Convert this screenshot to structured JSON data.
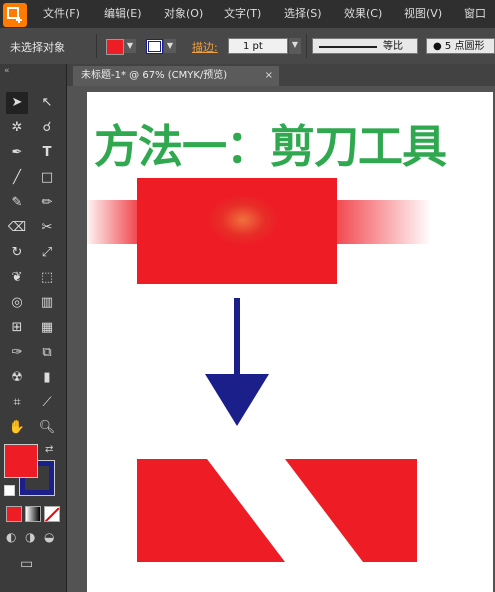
{
  "menu": {
    "items": [
      "文件(F)",
      "编辑(E)",
      "对象(O)",
      "文字(T)",
      "选择(S)",
      "效果(C)",
      "视图(V)",
      "窗口"
    ]
  },
  "control_bar": {
    "selection_label": "未选择对象",
    "stroke_label": "描边:",
    "stroke_weight": "1 pt",
    "stroke_profile": "等比",
    "brush": "5 点圆形"
  },
  "document_tab": {
    "title": "未标题-1* @ 67% (CMYK/预览)",
    "close": "×"
  },
  "artboard": {
    "heading": "方法一：剪刀工具"
  },
  "colors": {
    "fill": "#ee1c25",
    "stroke": "#1b1f8a",
    "heading": "#2fa84f",
    "arrow": "#1b1f8a"
  }
}
